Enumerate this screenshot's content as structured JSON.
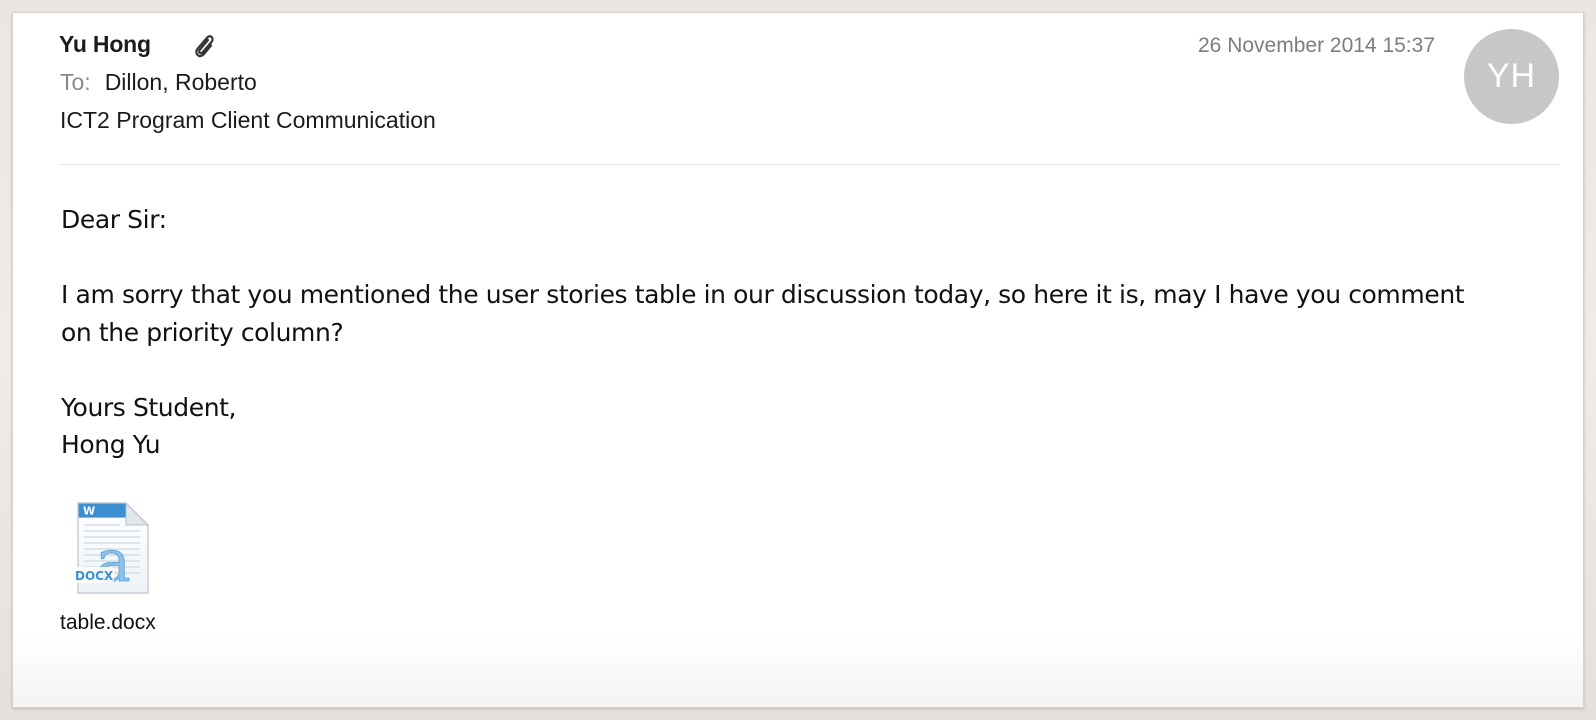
{
  "message": {
    "sender": "Yu Hong",
    "has_attachment_icon": "paperclip-icon",
    "date": "26 November 2014 15:37",
    "avatar_initials": "YH",
    "to_label": "To:",
    "to_value": "Dillon, Roberto",
    "subject": "ICT2 Program Client Communication"
  },
  "body": {
    "greeting": "Dear Sir:",
    "paragraph": "I am sorry that you mentioned the user stories table in our discussion today, so here it is, may I have you comment on the priority column?",
    "closing_line1": "Yours Student,",
    "closing_line2": "Hong Yu"
  },
  "attachment": {
    "icon": "docx-file-icon",
    "badge": "DOCX",
    "filename": "table.docx"
  },
  "colors": {
    "avatar_bg": "#c7c7c7",
    "date_text": "#7d7d7d",
    "to_label": "#8a8a8a",
    "docx_blue": "#3d8fd1"
  }
}
